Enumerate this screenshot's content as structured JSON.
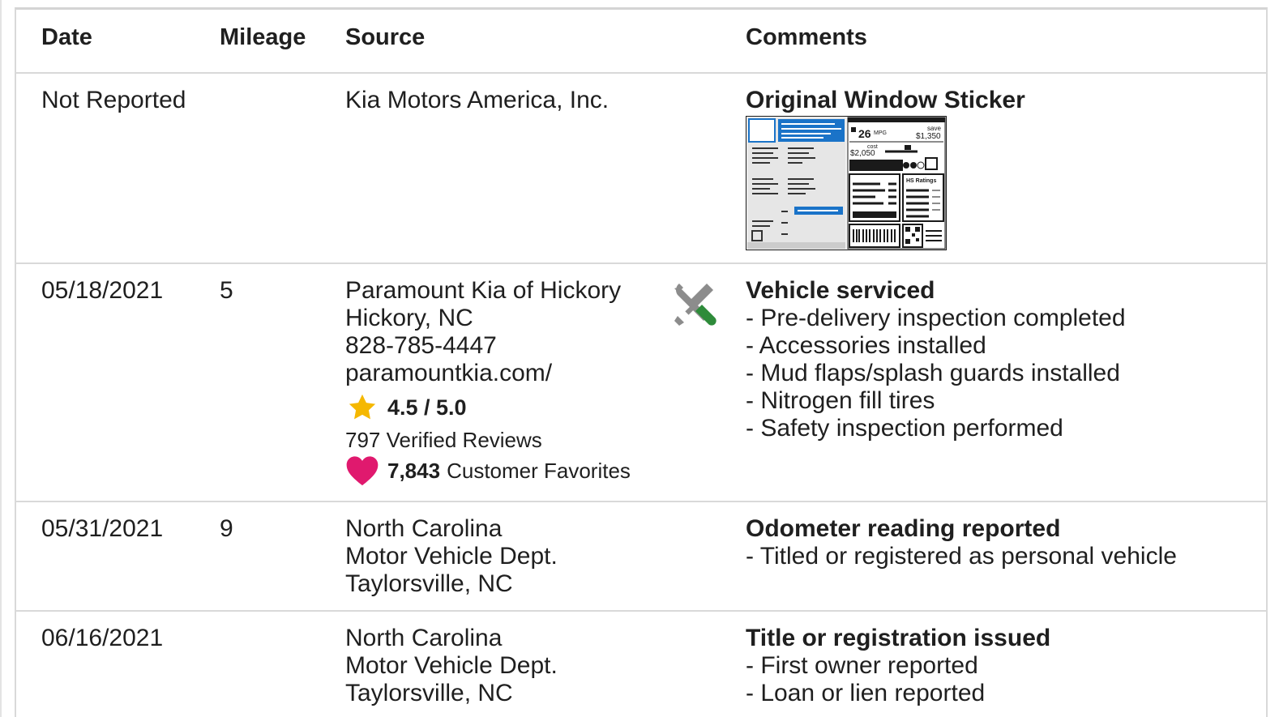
{
  "columns": {
    "date": "Date",
    "mileage": "Mileage",
    "source": "Source",
    "comments": "Comments"
  },
  "rows": [
    {
      "date": "Not Reported",
      "mileage": "",
      "source": [
        "Kia Motors America, Inc."
      ],
      "comment_title": "Original Window Sticker",
      "sticker": {
        "mpg": "26",
        "mpg_unit": "MPG",
        "save_label": "save",
        "save_value": "$1,350",
        "cost_label": "cost",
        "cost_value": "$2,050",
        "ratings_label": "HS Ratings",
        "accent_color": "#1a73c8"
      }
    },
    {
      "date": "05/18/2021",
      "mileage": "5",
      "source": [
        "Paramount Kia of Hickory",
        "Hickory, NC",
        "828-785-4447",
        "paramountkia.com/"
      ],
      "rating": "4.5 / 5.0",
      "reviews": "797 Verified Reviews",
      "favorites_count": "7,843",
      "favorites_label": "Customer Favorites",
      "icon": "service-tools-icon",
      "comment_title": "Vehicle serviced",
      "bullets": [
        "Pre-delivery inspection completed",
        "Accessories installed",
        "Mud flaps/splash guards installed",
        "Nitrogen fill tires",
        "Safety inspection performed"
      ]
    },
    {
      "date": "05/31/2021",
      "mileage": "9",
      "source": [
        "North Carolina",
        "Motor Vehicle Dept.",
        "Taylorsville, NC"
      ],
      "comment_title": "Odometer reading reported",
      "bullets": [
        "Titled or registered as personal vehicle"
      ]
    },
    {
      "date": "06/16/2021",
      "mileage": "",
      "source": [
        "North Carolina",
        "Motor Vehicle Dept.",
        "Taylorsville, NC"
      ],
      "comment_title": "Title or registration issued",
      "bullets": [
        "First owner reported",
        "Loan or lien reported"
      ]
    }
  ],
  "colors": {
    "star": "#f5b800",
    "heart": "#e0196e",
    "tool_gray": "#8c8c8c",
    "tool_green": "#2e8b3a"
  }
}
